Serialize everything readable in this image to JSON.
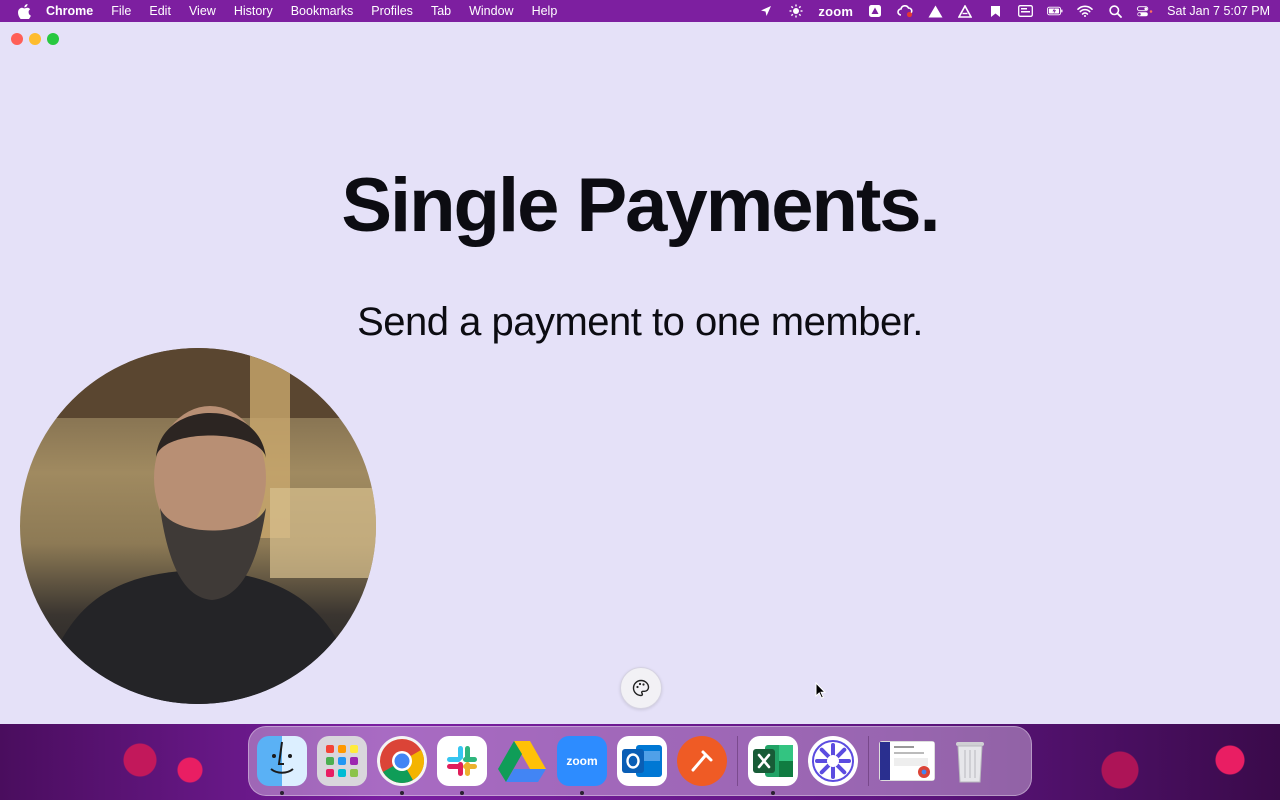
{
  "menubar": {
    "app_name": "Chrome",
    "items": [
      "File",
      "Edit",
      "View",
      "History",
      "Bookmarks",
      "Profiles",
      "Tab",
      "Window",
      "Help"
    ],
    "zoom_label": "zoom",
    "clock": "Sat Jan 7  5:07 PM"
  },
  "slide": {
    "title": "Single Payments.",
    "subtitle": "Send a payment to one member."
  },
  "dock": {
    "zoom_label": "zoom",
    "apps": [
      "finder",
      "launchpad",
      "chrome",
      "slack",
      "google-drive",
      "zoom",
      "outlook",
      "postman",
      "excel",
      "app-flower",
      "chrome-window",
      "trash"
    ]
  },
  "colors": {
    "menubar": "#7d1fa0",
    "window_bg": "#e5e1f8",
    "title_text": "#0c0c12"
  }
}
